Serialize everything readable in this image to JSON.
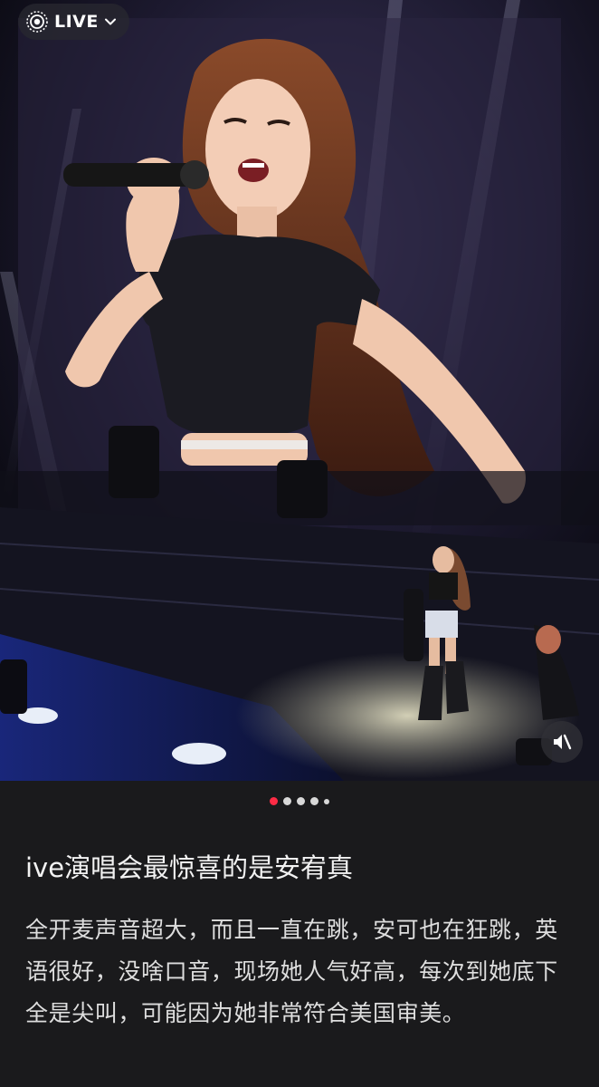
{
  "live_badge": {
    "label": "LIVE",
    "icon": "live-photo-icon",
    "chevron": "chevron-down-icon"
  },
  "photo": {
    "description_icon": "concert-photo",
    "mute_icon": "speaker-muted-icon"
  },
  "carousel": {
    "total": 5,
    "active_index": 0,
    "active_color": "#ff2b45"
  },
  "post": {
    "title": "ive演唱会最惊喜的是安宥真",
    "body": "全开麦声音超大，而且一直在跳，安可也在狂跳，英语很好，没啥口音，现场她人气好高，每次到她底下全是尖叫，可能因为她非常符合美国审美。"
  }
}
